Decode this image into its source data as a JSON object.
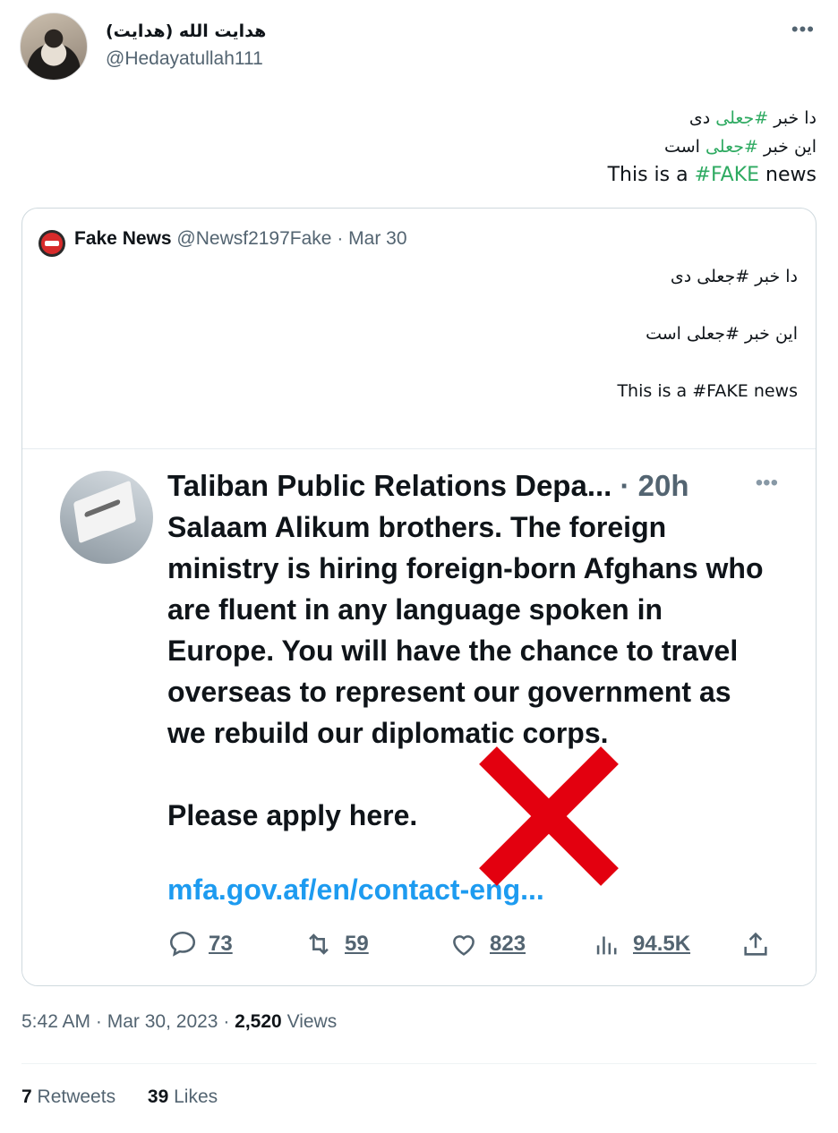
{
  "author": {
    "display_name": "هدایت الله (هدایت)",
    "handle": "@Hedayatullah111"
  },
  "tweet": {
    "lines": [
      {
        "before": "دا خبر ",
        "hashtag": "#جعلی",
        "after": " دی"
      },
      {
        "before": "این خبر ",
        "hashtag": "#جعلی",
        "after": " است"
      },
      {
        "before": "This is a ",
        "hashtag": "#FAKE",
        "after": " news"
      }
    ]
  },
  "quote": {
    "name": "Fake News",
    "handle": "@Newsf2197Fake",
    "date": "· Mar 30",
    "lines": [
      "دا خبر #جعلی دی",
      "این خبر #جعلی است",
      "This is a #FAKE news"
    ]
  },
  "embedded": {
    "name": "Taliban Public Relations Depa...",
    "time": "· 20h",
    "body": "Salaam Alikum brothers. The foreign ministry is hiring foreign-born Afghans who are fluent in any language spoken in Europe. You will have the chance to travel overseas to represent our government as we rebuild our diplomatic corps.",
    "cta": "Please apply here.",
    "link": "mfa.gov.af/en/contact-eng...",
    "replies": "73",
    "retweets": "59",
    "likes": "823",
    "views": "94.5K",
    "icons": [
      "reply-icon",
      "retweet-icon",
      "like-icon",
      "views-icon",
      "share-icon"
    ],
    "overlay_mark_color": "#e3000f"
  },
  "meta": {
    "time": "5:42 AM",
    "date": "Mar 30, 2023",
    "views_count": "2,520",
    "views_label": "Views",
    "retweets_count": "7",
    "retweets_label": "Retweets",
    "likes_count": "39",
    "likes_label": "Likes"
  },
  "colors": {
    "hashtag_green": "#2eaa61",
    "link_blue": "#1d9bf0",
    "muted": "#536471"
  }
}
